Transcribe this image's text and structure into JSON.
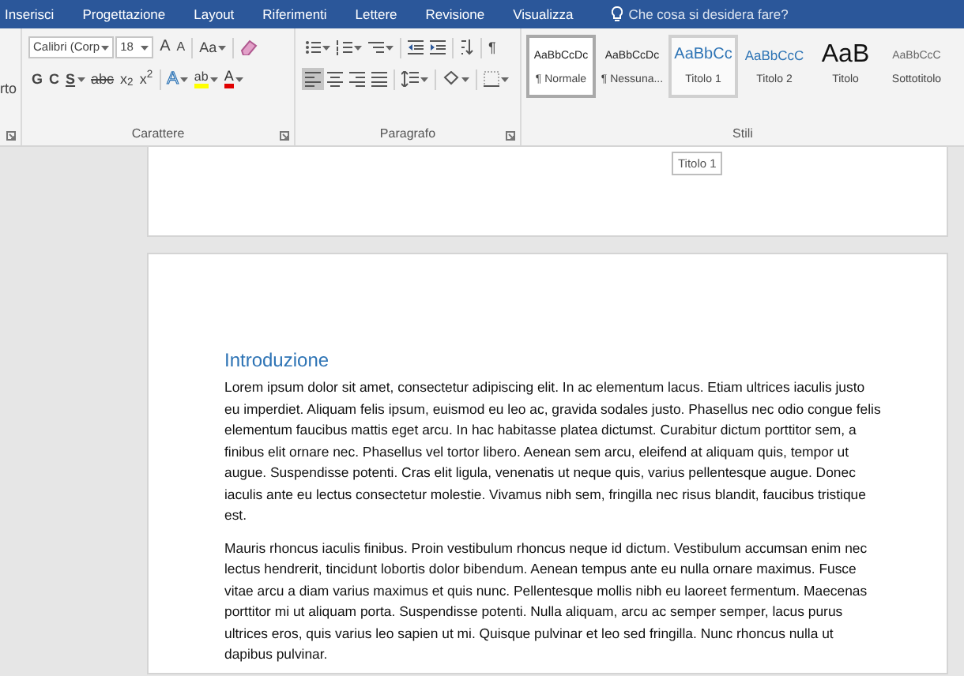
{
  "tabs": [
    {
      "label": "Inserisci",
      "selected": false
    },
    {
      "label": "Progettazione",
      "selected": false
    },
    {
      "label": "Layout",
      "selected": false
    },
    {
      "label": "Riferimenti",
      "selected": false
    },
    {
      "label": "Lettere",
      "selected": false
    },
    {
      "label": "Revisione",
      "selected": false
    },
    {
      "label": "Visualizza",
      "selected": false
    }
  ],
  "tell_me": {
    "placeholder": "Che cosa si desidera fare?"
  },
  "clipboard_group": {
    "label_fragment": "rto"
  },
  "font_group": {
    "title": "Carattere",
    "font_name": "Calibri (Corp",
    "font_size": "18",
    "row1": [
      {
        "kind": "grow",
        "label": "A"
      },
      {
        "kind": "shrink",
        "label": "A"
      },
      {
        "kind": "case",
        "label": "Aa",
        "dropdown": true
      },
      {
        "kind": "eraser",
        "dropdown": false
      }
    ],
    "row2": [
      {
        "kind": "bold",
        "label": "G",
        "dropdown": false
      },
      {
        "kind": "italic",
        "label": "C",
        "dropdown": false
      },
      {
        "kind": "underline",
        "label": "S",
        "dropdown": true
      },
      {
        "kind": "strike",
        "label": "abc",
        "dropdown": false
      },
      {
        "kind": "sub",
        "label": "x$_{2}$",
        "dropdown": false
      },
      {
        "kind": "sup",
        "label": "x$^{2}$",
        "dropdown": false
      },
      {
        "kind": "effects",
        "label": "A",
        "dropdown": true
      },
      {
        "kind": "highlight",
        "label": "ab",
        "dropdown": true
      },
      {
        "kind": "font_color",
        "label": "A",
        "dropdown": true
      }
    ]
  },
  "paragraph_group": {
    "title": "Paragrafo",
    "row1": [
      {
        "kind": "bullets",
        "dropdown": true
      },
      {
        "kind": "numbering",
        "dropdown": true
      },
      {
        "kind": "multilevel",
        "dropdown": true
      },
      {
        "kind": "outdent",
        "dropdown": false
      },
      {
        "kind": "indent",
        "dropdown": false
      },
      {
        "kind": "sort",
        "dropdown": false
      },
      {
        "kind": "pilcrow",
        "label": "¶",
        "dropdown": false
      }
    ],
    "alignment": [
      {
        "kind": "left",
        "selected": true
      },
      {
        "kind": "center",
        "selected": false
      },
      {
        "kind": "right",
        "selected": false
      },
      {
        "kind": "justify",
        "selected": false
      }
    ],
    "row2": [
      {
        "kind": "line_spacing",
        "dropdown": true
      },
      {
        "kind": "shading",
        "dropdown": true
      },
      {
        "kind": "borders",
        "dropdown": true
      }
    ]
  },
  "styles_group": {
    "title": "Stili",
    "styles": [
      {
        "kind": "normal",
        "preview": "AaBbCcDc",
        "name": "¶ Normale",
        "selected": true,
        "hovered": false
      },
      {
        "kind": "normal",
        "preview": "AaBbCcDc",
        "name": "¶ Nessuna...",
        "selected": false,
        "hovered": false
      },
      {
        "kind": "heading1",
        "preview": "AaBbCc",
        "name": "Titolo 1",
        "selected": false,
        "hovered": true
      },
      {
        "kind": "heading2",
        "preview": "AaBbCcC",
        "name": "Titolo 2",
        "selected": false,
        "hovered": false
      },
      {
        "kind": "title",
        "preview": "AaB",
        "name": "Titolo",
        "selected": false,
        "hovered": false
      },
      {
        "kind": "subtitle",
        "preview": "AaBbCcC",
        "name": "Sottotitolo",
        "selected": false,
        "hovered": false
      }
    ],
    "tooltip": "Titolo 1"
  },
  "document": {
    "heading": "Introduzione",
    "paragraphs": [
      "Lorem ipsum dolor sit amet, consectetur adipiscing elit. In ac elementum lacus. Etiam ultrices iaculis justo eu imperdiet. Aliquam felis ipsum, euismod eu leo ac, gravida sodales justo. Phasellus nec odio congue felis elementum faucibus mattis eget arcu. In hac habitasse platea dictumst. Curabitur dictum porttitor sem, a finibus elit ornare nec. Phasellus vel tortor libero. Aenean sem arcu, eleifend at aliquam quis, tempor ut augue. Suspendisse potenti. Cras elit ligula, venenatis ut neque quis, varius pellentesque augue. Donec iaculis ante eu lectus consectetur molestie. Vivamus nibh sem, fringilla nec risus blandit, faucibus tristique est.",
      "Mauris rhoncus iaculis finibus. Proin vestibulum rhoncus neque id dictum. Vestibulum accumsan enim nec lectus hendrerit, tincidunt lobortis dolor bibendum. Aenean tempus ante eu nulla ornare maximus. Fusce vitae arcu a diam varius maximus et quis nunc. Pellentesque mollis nibh eu laoreet fermentum. Maecenas porttitor mi ut aliquam porta. Suspendisse potenti. Nulla aliquam, arcu ac semper semper, lacus purus ultrices eros, quis varius leo sapien ut mi. Quisque pulvinar et leo sed fringilla. Nunc rhoncus nulla ut dapibus pulvinar."
    ]
  }
}
